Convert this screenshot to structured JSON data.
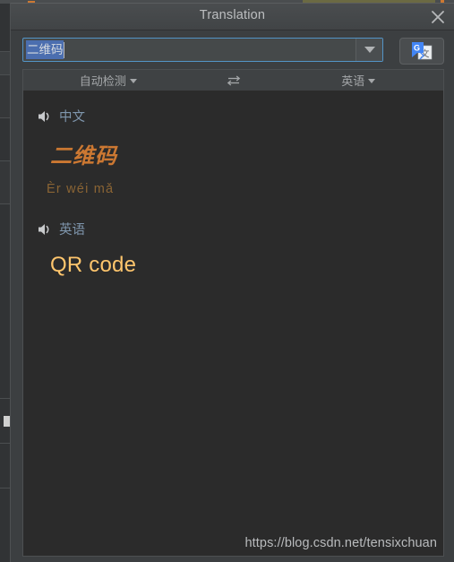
{
  "window": {
    "title": "Translation",
    "close_icon": "close-icon"
  },
  "search": {
    "value": "二维码",
    "dropdown_icon": "chevron-down-icon",
    "engine_button_icon": "google-translate-icon",
    "engine_button_label": "Google Translate"
  },
  "language_bar": {
    "source_label": "自动检测",
    "source_dropdown_icon": "chevron-down-icon",
    "swap_icon": "swap-arrows-icon",
    "target_label": "英语",
    "target_dropdown_icon": "chevron-down-icon"
  },
  "results": [
    {
      "lang_label": "中文",
      "speaker_icon": "speaker-icon",
      "term": "二维码",
      "pinyin": "Èr wéi mǎ"
    },
    {
      "lang_label": "英语",
      "speaker_icon": "speaker-icon",
      "term": "QR code"
    }
  ],
  "watermark": {
    "text": "https://blog.csdn.net/tensixchuan"
  },
  "colors": {
    "accent_orange": "#cc7832",
    "accent_gold": "#ffc66d",
    "pinyin_brown": "#8a6434",
    "lang_blue": "#7f96ad",
    "focus_border": "#5394c6",
    "selection_blue": "#4b6eaf",
    "result_bg": "#2b2b2b",
    "dialog_bg": "#3c3f41"
  }
}
